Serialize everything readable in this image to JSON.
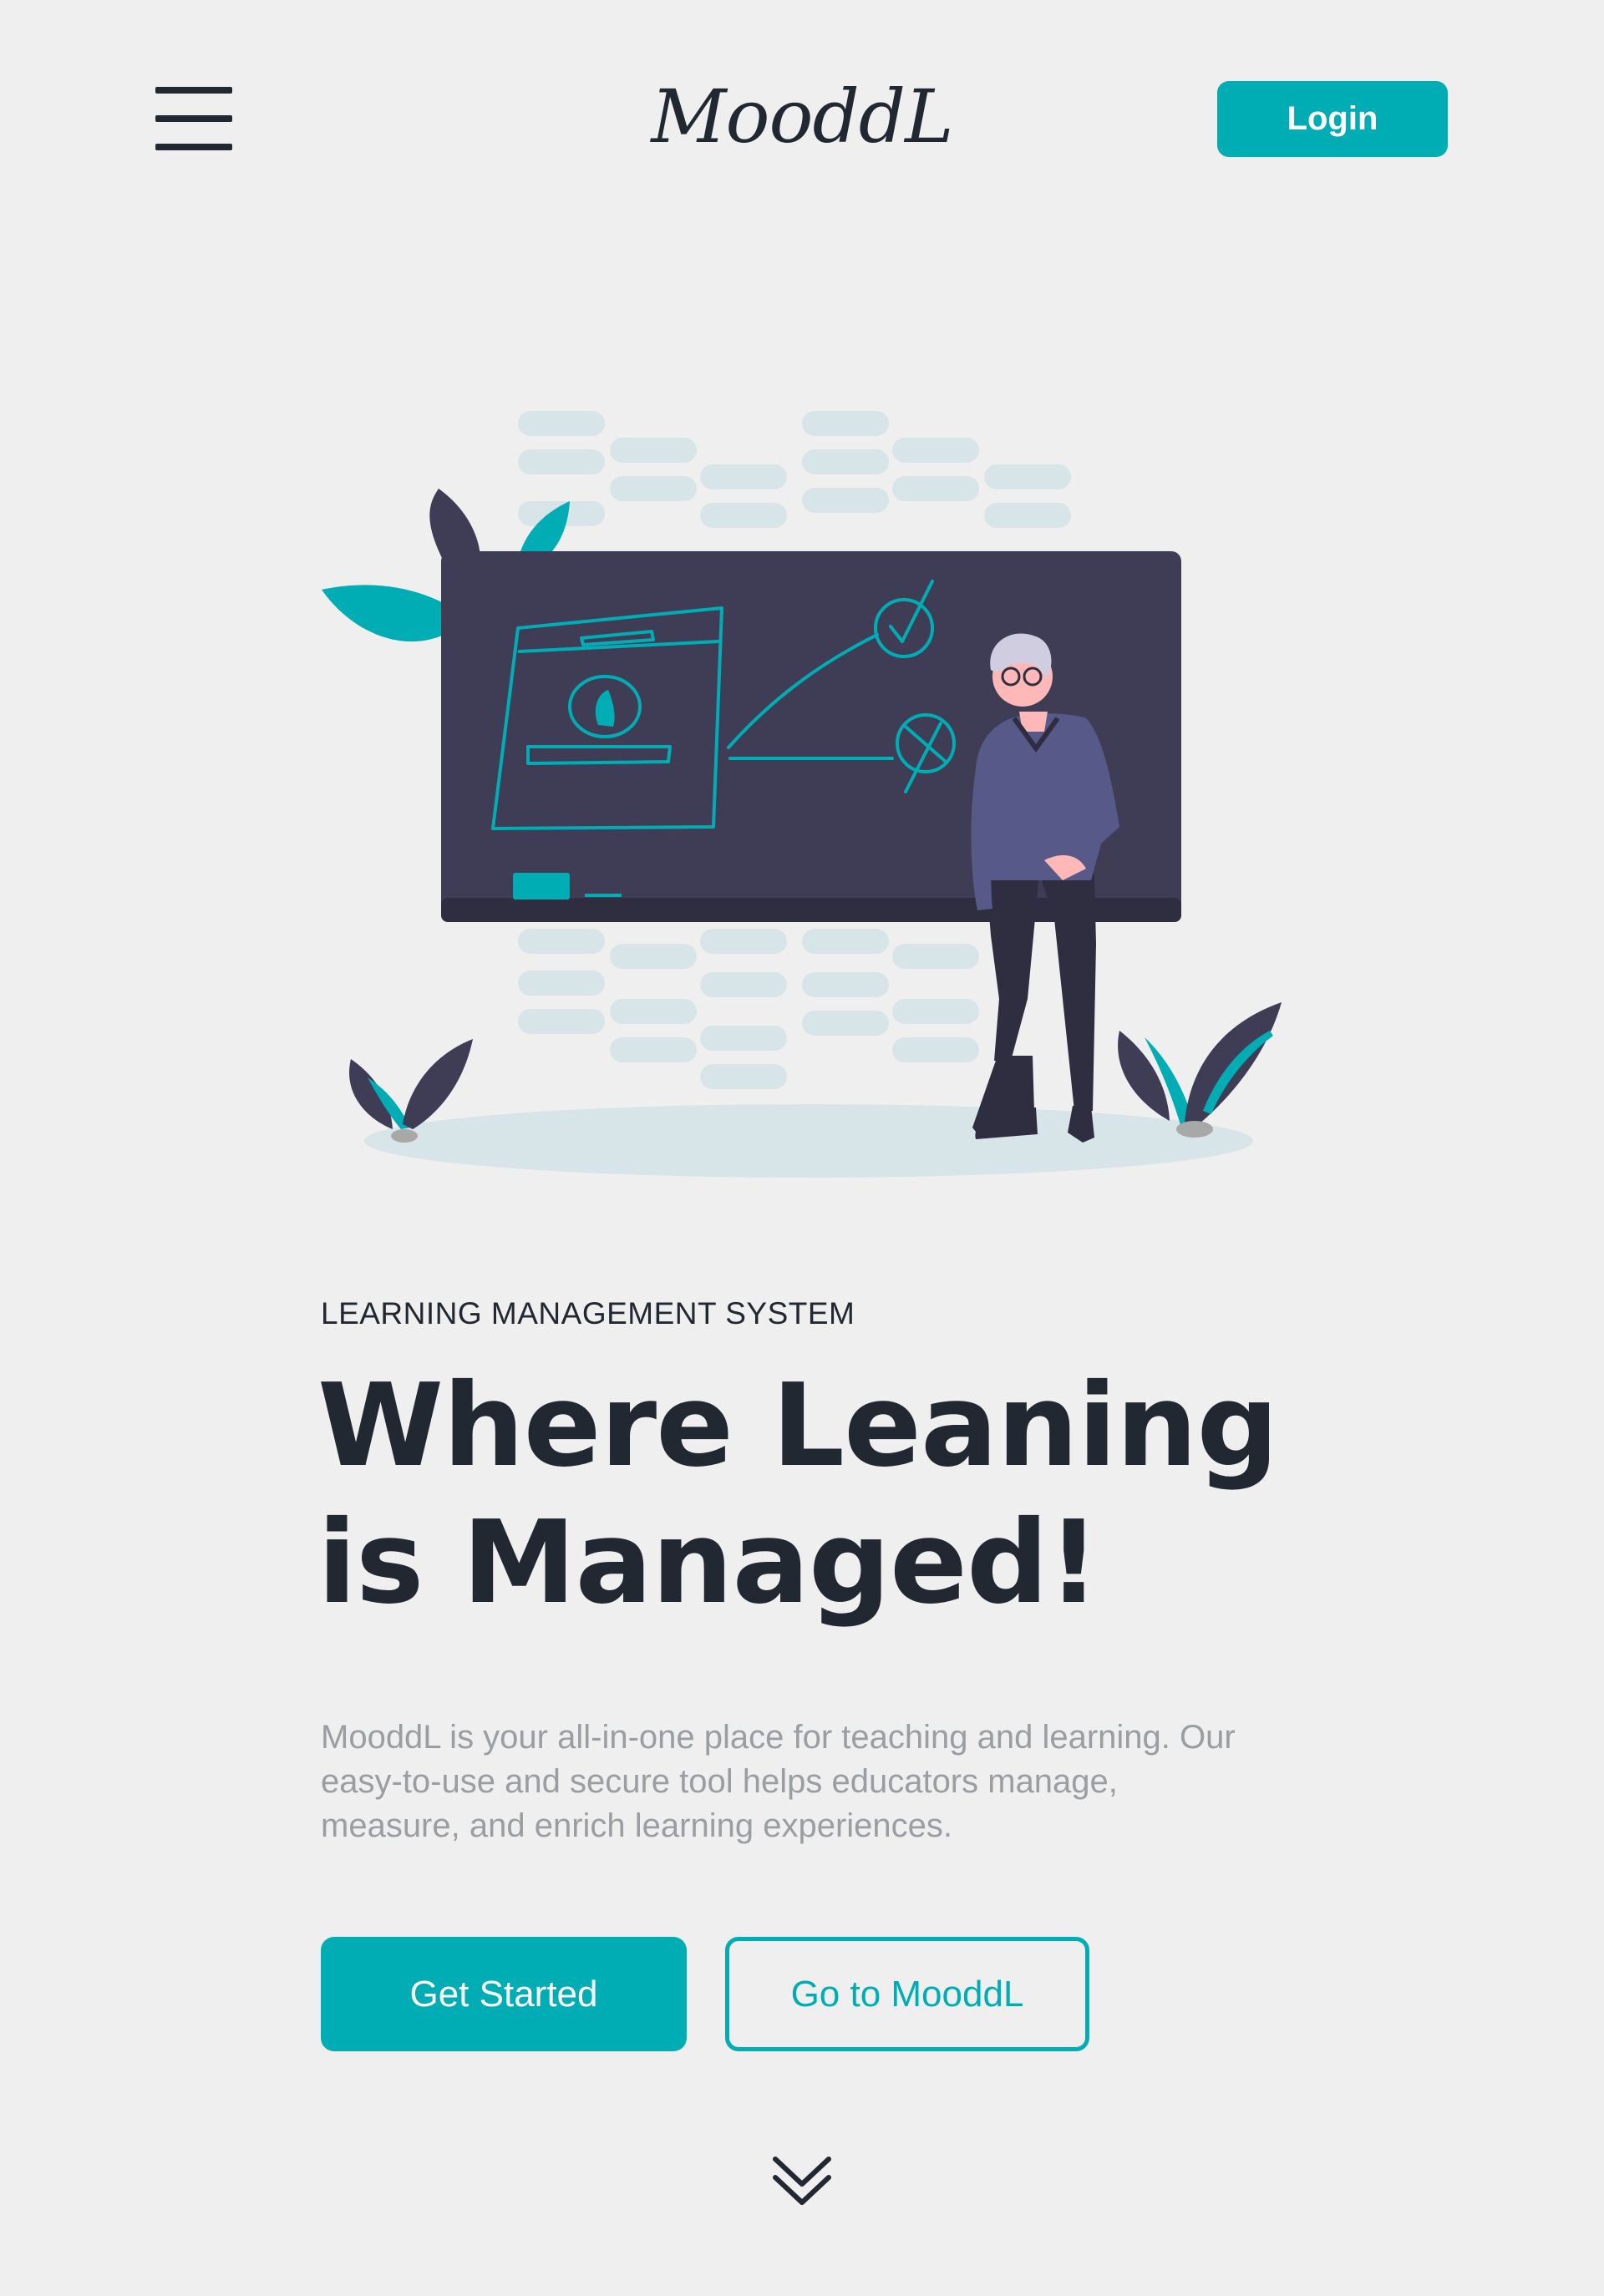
{
  "header": {
    "brand": "MooddL",
    "login_label": "Login"
  },
  "hero": {
    "eyebrow": "LEARNING MANAGEMENT SYSTEM",
    "headline_line1": "Where Leaning",
    "headline_line2": "is Managed!",
    "description_line1": "MooddL is your all-in-one place for teaching and learning. Our",
    "description_line2": "easy-to-use and secure tool helps educators manage,",
    "description_line3": "measure, and enrich learning experiences.",
    "primary_cta": "Get Started",
    "secondary_cta": "Go to MooddL"
  },
  "icons": {
    "menu": "hamburger-menu-icon",
    "scroll": "double-chevron-down-icon"
  },
  "colors": {
    "accent": "#00adb5",
    "dark": "#222831",
    "board": "#3f3d56",
    "background": "#efefef",
    "muted_text": "#9a9ea2"
  }
}
